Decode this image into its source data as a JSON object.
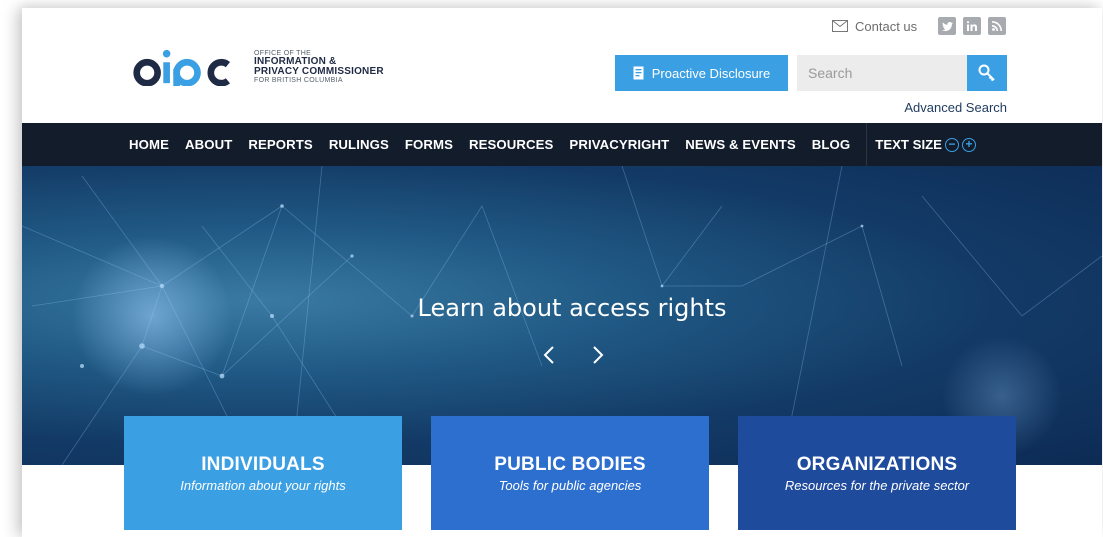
{
  "header": {
    "contact_label": "Contact us",
    "social": [
      "twitter-icon",
      "linkedin-icon",
      "rss-icon"
    ],
    "logo": {
      "mark": "oipc",
      "line1": "OFFICE OF THE",
      "line2": "INFORMATION &",
      "line3": "PRIVACY COMMISSIONER",
      "line4": "FOR BRITISH COLUMBIA"
    },
    "proactive_label": "Proactive Disclosure",
    "search_placeholder": "Search",
    "advanced_search": "Advanced Search"
  },
  "nav": {
    "items": [
      "HOME",
      "ABOUT",
      "REPORTS",
      "RULINGS",
      "FORMS",
      "RESOURCES",
      "PRIVACYRIGHT",
      "NEWS & EVENTS",
      "BLOG"
    ],
    "text_size_label": "TEXT SIZE"
  },
  "hero": {
    "title": "Learn about access rights"
  },
  "cards": [
    {
      "title": "INDIVIDUALS",
      "subtitle": "Information about your rights",
      "color": "#3b9fe4"
    },
    {
      "title": "PUBLIC BODIES",
      "subtitle": "Tools for public agencies",
      "color": "#2d6fce"
    },
    {
      "title": "ORGANIZATIONS",
      "subtitle": "Resources for the private sector",
      "color": "#1f4b9d"
    }
  ],
  "colors": {
    "accent": "#3b9fe4",
    "nav_bg": "#131c2b",
    "logo_dark": "#1f2a44"
  }
}
